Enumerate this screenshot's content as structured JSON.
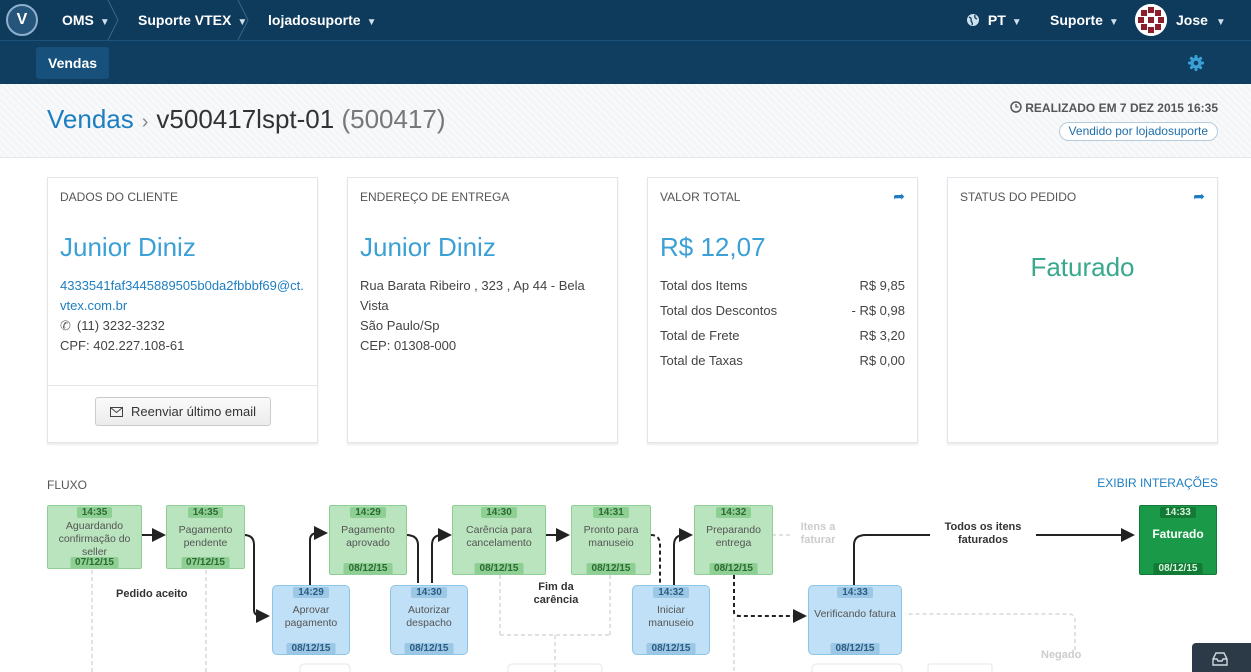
{
  "nav": {
    "logo": "V",
    "breadcrumbs": [
      "OMS",
      "Suporte VTEX",
      "lojadosuporte"
    ],
    "language": "PT",
    "support": "Suporte",
    "user": "Jose"
  },
  "subnav": {
    "active_tab": "Vendas"
  },
  "header": {
    "section": "Vendas",
    "order_id": "v500417lspt-01",
    "order_number": "(500417)",
    "realizado": "REALIZADO EM 7 DEZ 2015 16:35",
    "vendido": "Vendido por lojadosuporte"
  },
  "cliente": {
    "title": "DADOS DO CLIENTE",
    "name": "Junior Diniz",
    "email_line1": "4333541faf3445889505b0da2fbbbf69@ct.",
    "email_line2": "vtex.com.br",
    "phone": "(11) 3232-3232",
    "cpf": "CPF: 402.227.108-61",
    "button": "Reenviar último email"
  },
  "endereco": {
    "title": "ENDEREÇO DE ENTREGA",
    "name": "Junior Diniz",
    "line1": "Rua Barata Ribeiro , 323 , Ap 44  - Bela",
    "line2": "Vista",
    "line3": "São Paulo/Sp",
    "line4": "CEP: 01308-000"
  },
  "valor": {
    "title": "VALOR TOTAL",
    "total": "R$ 12,07",
    "rows": [
      {
        "label": "Total dos Items",
        "value": "R$ 9,85"
      },
      {
        "label": "Total dos Descontos",
        "value": "- R$ 0,98"
      },
      {
        "label": "Total de Frete",
        "value": "R$ 3,20"
      },
      {
        "label": "Total de Taxas",
        "value": "R$ 0,00"
      }
    ]
  },
  "status": {
    "title": "STATUS DO PEDIDO",
    "value": "Faturado"
  },
  "fluxo": {
    "title": "FLUXO",
    "exibir": "EXIBIR INTERAÇÕES",
    "nodes": {
      "n1": {
        "time": "14:35",
        "label": "Aguardando confirmação do seller",
        "date": "07/12/15"
      },
      "n2": {
        "time": "14:35",
        "label": "Pagamento pendente",
        "date": "07/12/15"
      },
      "n3": {
        "time": "14:29",
        "label": "Aprovar pagamento",
        "date": "08/12/15"
      },
      "n4": {
        "time": "14:29",
        "label": "Pagamento aprovado",
        "date": "08/12/15"
      },
      "n5": {
        "time": "14:30",
        "label": "Autorizar despacho",
        "date": "08/12/15"
      },
      "n6": {
        "time": "14:30",
        "label": "Carência para cancelamento",
        "date": "08/12/15"
      },
      "n7": {
        "time": "14:31",
        "label": "Pronto para manuseio",
        "date": "08/12/15"
      },
      "n8": {
        "time": "14:32",
        "label": "Iniciar manuseio",
        "date": "08/12/15"
      },
      "n9": {
        "time": "14:32",
        "label": "Preparando entrega",
        "date": "08/12/15"
      },
      "n10": {
        "time": "14:33",
        "label": "Verificando fatura",
        "date": "08/12/15"
      },
      "n11": {
        "time": "14:33",
        "label": "Faturado",
        "date": "08/12/15"
      }
    },
    "labels": {
      "pedido_aceito": "Pedido aceito",
      "fim_carencia_1": "Fim da",
      "fim_carencia_2": "carência",
      "itens_1": "Itens a",
      "itens_2": "faturar",
      "todos_1": "Todos os itens",
      "todos_2": "faturados",
      "negado": "Negado"
    }
  },
  "colors": {
    "topbar": "#0e3a5c",
    "link": "#1d7ec1",
    "accent_name": "#3aa0d6",
    "status": "#3aa88d",
    "node_green": "#b9e4bd",
    "node_blue": "#bfe0f6",
    "node_final": "#1a9a48"
  }
}
